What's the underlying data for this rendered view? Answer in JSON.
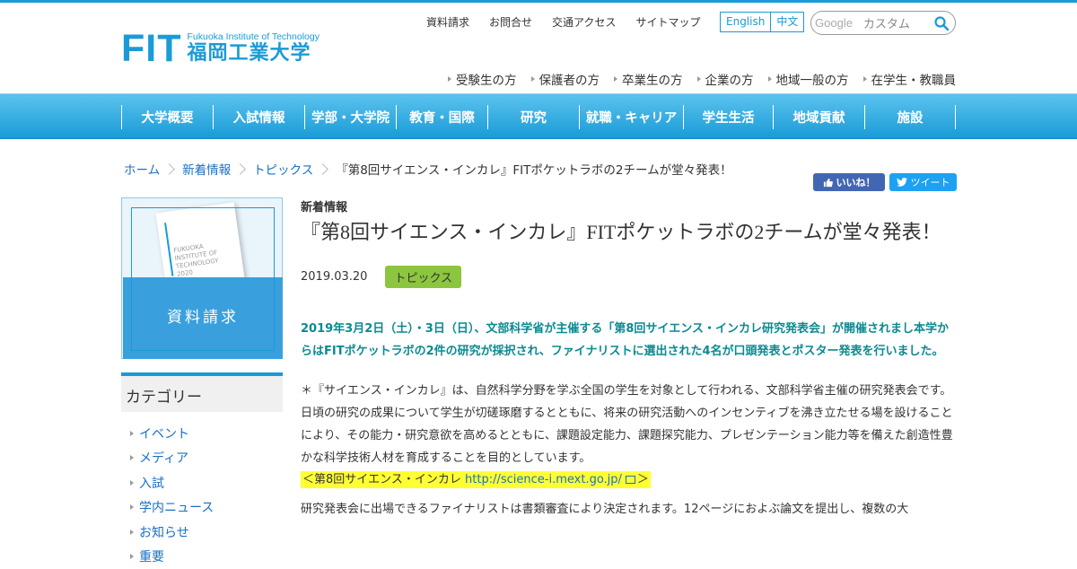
{
  "header": {
    "logo_mark": "FIT",
    "logo_en": "Fukuoka Institute of Technology",
    "logo_ja": "福岡工業大学",
    "util_links": [
      "資料請求",
      "お問合せ",
      "交通アクセス",
      "サイトマップ"
    ],
    "lang": [
      "English",
      "中文"
    ],
    "search": {
      "brand": "Google",
      "placeholder": "カスタム"
    },
    "audience": [
      "受験生の方",
      "保護者の方",
      "卒業生の方",
      "企業の方",
      "地域一般の方",
      "在学生・教職員"
    ]
  },
  "gnav": [
    "大学概要",
    "入試情報",
    "学部・大学院",
    "教育・国際",
    "研究",
    "就職・キャリア",
    "学生生活",
    "地域貢献",
    "施設"
  ],
  "breadcrumb": [
    "ホーム",
    "新着情報",
    "トピックス",
    "『第8回サイエンス・インカレ』FITポケットラボの2チームが堂々発表！"
  ],
  "social": {
    "like": "いいね！",
    "tweet": "ツイート"
  },
  "sidebar": {
    "doc_button": "資料請求",
    "cover_text": "FUKUOKA INSTITUTE OF TECHNOLOGY 2020",
    "category_title": "カテゴリー",
    "categories": [
      "イベント",
      "メディア",
      "入試",
      "学内ニュース",
      "お知らせ",
      "重要"
    ]
  },
  "article": {
    "kicker": "新着情報",
    "title": "『第8回サイエンス・インカレ』FITポケットラボの2チームが堂々発表！",
    "date": "2019.03.20",
    "tag": "トピックス",
    "lead": "2019年3月2日（土）・3日（日）、文部科学省が主催する「第8回サイエンス・インカレ研究発表会」が開催されまし本学からはFITポケットラボの2件の研究が採択され、ファイナリストに選出された4名が口頭発表とポスター発表を行いました。",
    "body": "＊『サイエンス・インカレ』は、自然科学分野を学ぶ全国の学生を対象として行われる、文部科学省主催の研究発表会です。日頃の研究の成果について学生が切磋琢磨するとともに、将来の研究活動へのインセンティブを沸き立たせる場を設けることにより、その能力・研究意欲を高めるとともに、課題設定能力、課題探究能力、プレゼンテーション能力等を備えた創造性豊かな科学技術人材を育成することを目的としています。",
    "link_prefix": "＜第8回サイエンス・インカレ",
    "link_url": "http://science-i.mext.go.jp/",
    "link_suffix": "＞",
    "more": "研究発表会に出場できるファイナリストは書類審査により決定されます。12ページにおよぶ論文を提出し、複数の大"
  },
  "colors": {
    "brand": "#1a9bd7",
    "lead_text": "#0b8a91",
    "tag": "#8cc63f",
    "highlight": "#ffff33"
  }
}
